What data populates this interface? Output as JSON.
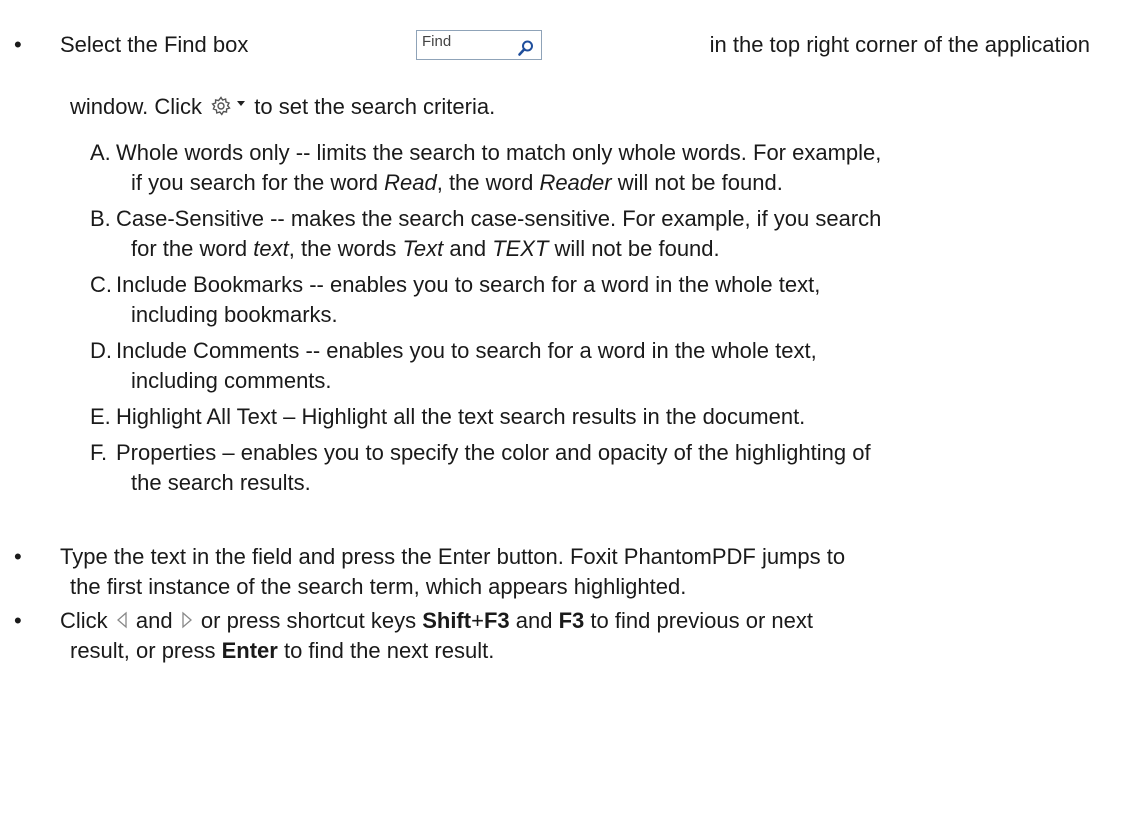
{
  "b1": {
    "p1": "Select the Find box",
    "find_placeholder": "Find",
    "p2": "in the top right corner of the application",
    "p3": "window. Click",
    "p4": "to set the search criteria."
  },
  "items": [
    {
      "letter": "A.",
      "l1": "Whole words only -- limits the search to match only whole words. For example,",
      "l2a": "if you search for the word ",
      "l2b": "Read",
      "l2c": ", the word ",
      "l2d": "Reader",
      "l2e": " will not be found."
    },
    {
      "letter": "B.",
      "l1": "Case-Sensitive -- makes the search case-sensitive. For example, if you search",
      "l2a": "for the word ",
      "l2b": "text",
      "l2c": ", the words ",
      "l2d": "Text",
      "l2e": " and ",
      "l2f": "TEXT",
      "l2g": " will not be found."
    },
    {
      "letter": "C.",
      "l1": "Include Bookmarks -- enables you to search for a word in the whole text,",
      "l2": "including bookmarks."
    },
    {
      "letter": "D.",
      "l1": "Include Comments -- enables you to search for a word in the whole text,",
      "l2": "including comments."
    },
    {
      "letter": "E.",
      "l1": "Highlight All Text – Highlight all the text search results in the document."
    },
    {
      "letter": "F.",
      "l1": "Properties – enables you to specify the color and opacity of the highlighting of",
      "l2": "the search results."
    }
  ],
  "b2": {
    "l1": "Type the text in the field and press the Enter button. Foxit PhantomPDF jumps to",
    "l2": "the first instance of the search term, which appears highlighted."
  },
  "b3": {
    "click": "Click",
    "and": "and",
    "or_press": "or press shortcut keys",
    "shift": "Shift",
    "plus": "+",
    "f3a": "F3",
    "and2": "and",
    "f3b": "F3",
    "tail": "to find previous or next",
    "l2a": "result, or press ",
    "enter": "Enter",
    "l2b": " to find the next result."
  },
  "bullet_char": "•",
  "icons": [
    "magnifier-icon",
    "gear-icon",
    "dropdown-arrow-icon",
    "previous-arrow-icon",
    "next-arrow-icon"
  ]
}
